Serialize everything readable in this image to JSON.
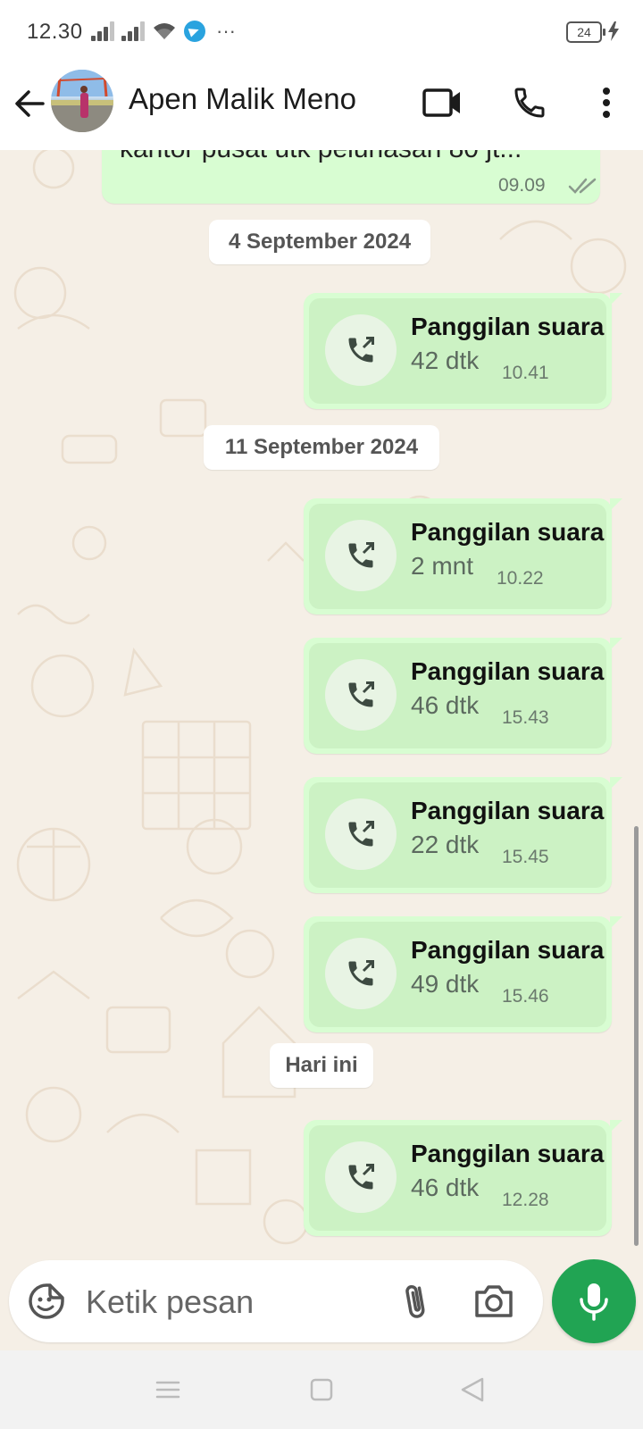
{
  "status_bar": {
    "time": "12.30",
    "battery_level": "24",
    "icons": [
      "signal-icon",
      "signal-icon",
      "wifi-icon",
      "telegram-icon",
      "more-notifications-icon",
      "battery-icon",
      "charging-icon"
    ]
  },
  "header": {
    "contact_name": "Apen Malik Meno",
    "icons": [
      "back-arrow-icon",
      "video-call-icon",
      "voice-call-icon",
      "more-vert-icon"
    ]
  },
  "chat": {
    "partial_message": {
      "text": "kantor pusat utk pelunasan 80 jt...",
      "time": "09.09",
      "status": "read"
    },
    "groups": [
      {
        "date": "4 September 2024",
        "calls": [
          {
            "title": "Panggilan suara",
            "duration": "42 dtk",
            "time": "10.41"
          }
        ]
      },
      {
        "date": "11 September 2024",
        "calls": [
          {
            "title": "Panggilan suara",
            "duration": "2 mnt",
            "time": "10.22"
          },
          {
            "title": "Panggilan suara",
            "duration": "46 dtk",
            "time": "15.43"
          },
          {
            "title": "Panggilan suara",
            "duration": "22 dtk",
            "time": "15.45"
          },
          {
            "title": "Panggilan suara",
            "duration": "49 dtk",
            "time": "15.46"
          }
        ]
      },
      {
        "date": "Hari ini",
        "calls": [
          {
            "title": "Panggilan suara",
            "duration": "46 dtk",
            "time": "12.28"
          }
        ]
      }
    ]
  },
  "composer": {
    "placeholder": "Ketik pesan",
    "value": "",
    "icons": [
      "sticker-icon",
      "attach-icon",
      "camera-icon",
      "mic-icon"
    ]
  },
  "nav_bar": {
    "icons": [
      "menu-icon",
      "home-icon",
      "back-icon"
    ]
  },
  "colors": {
    "bubble_out": "#d8fdd2",
    "call_inner": "#ccf2c4",
    "accent_green": "#21a453",
    "chat_bg": "#f5efe6",
    "read_ticks": "#8a9a8c"
  }
}
